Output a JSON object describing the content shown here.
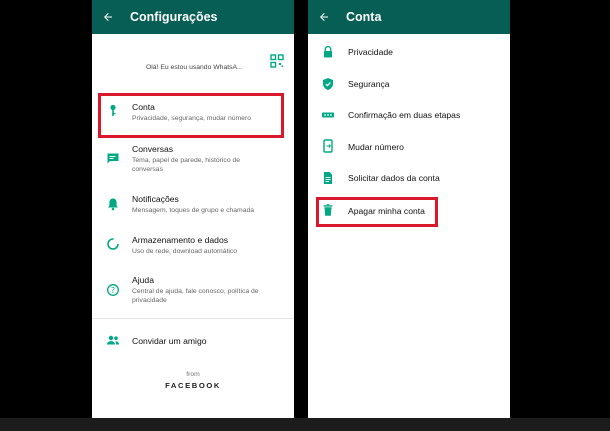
{
  "left_screen": {
    "title": "Configurações",
    "status": "Olá! Eu estou usando WhatsA...",
    "items": [
      {
        "icon": "key-icon",
        "title": "Conta",
        "subtitle": "Privacidade, segurança, mudar número"
      },
      {
        "icon": "chat-icon",
        "title": "Conversas",
        "subtitle": "Tema, papel de parede, histórico de conversas"
      },
      {
        "icon": "bell-icon",
        "title": "Notificações",
        "subtitle": "Mensagem, toques de grupo e chamada"
      },
      {
        "icon": "data-usage-icon",
        "title": "Armazenamento e dados",
        "subtitle": "Uso de rede, download automático"
      },
      {
        "icon": "help-icon",
        "title": "Ajuda",
        "subtitle": "Central de ajuda, fale conosco, política de privacidade"
      },
      {
        "icon": "people-icon",
        "title": "Convidar um amigo",
        "subtitle": ""
      }
    ],
    "from": "from",
    "brand": "FACEBOOK"
  },
  "right_screen": {
    "title": "Conta",
    "items": [
      {
        "icon": "lock-icon",
        "title": "Privacidade"
      },
      {
        "icon": "shield-icon",
        "title": "Segurança"
      },
      {
        "icon": "dots-icon",
        "title": "Confirmação em duas etapas"
      },
      {
        "icon": "phone-change-icon",
        "title": "Mudar número"
      },
      {
        "icon": "document-icon",
        "title": "Solicitar dados da conta"
      },
      {
        "icon": "trash-icon",
        "title": "Apagar minha conta"
      }
    ]
  },
  "colors": {
    "header": "#075e54",
    "icon": "#00a884",
    "highlight": "#d9182b"
  }
}
